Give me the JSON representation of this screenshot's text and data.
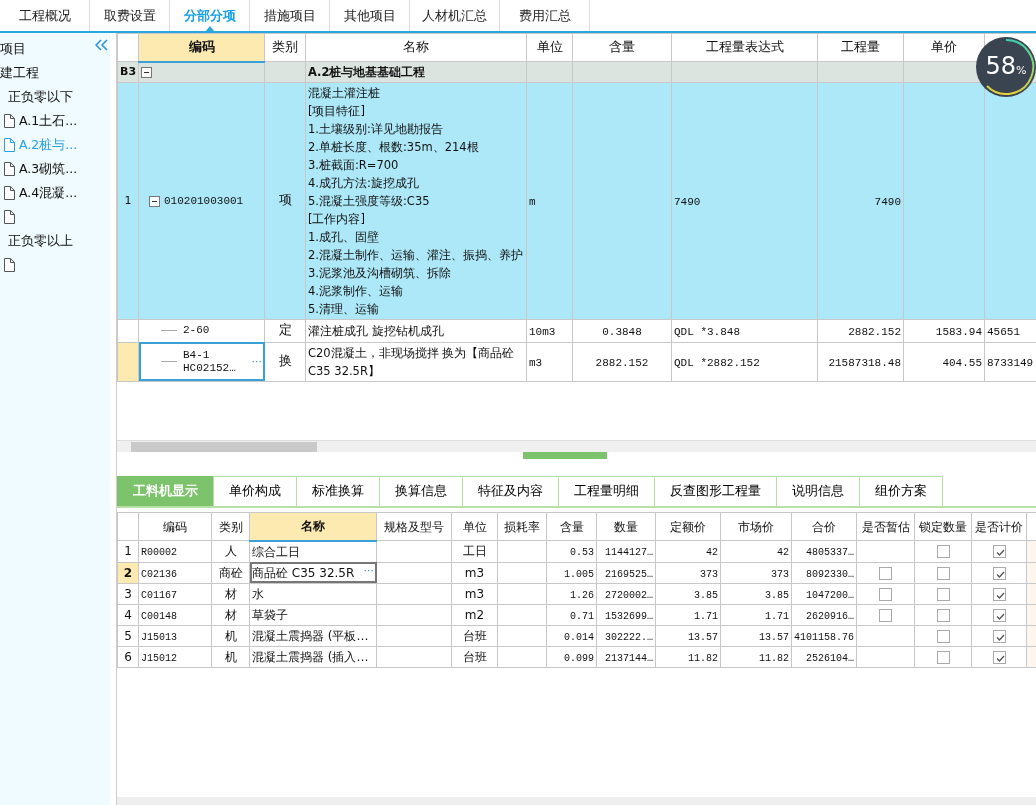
{
  "main_tabs": [
    {
      "label": "工程概况",
      "selected": false
    },
    {
      "label": "取费设置",
      "selected": false
    },
    {
      "label": "分部分项",
      "selected": true
    },
    {
      "label": "措施项目",
      "selected": false
    },
    {
      "label": "其他项目",
      "selected": false
    },
    {
      "label": "人材机汇总",
      "selected": false
    },
    {
      "label": "费用汇总",
      "selected": false
    }
  ],
  "sidebar": {
    "items": [
      {
        "label": "项目",
        "children": [
          {
            "label": "建工程",
            "children": [
              {
                "label": "正负零以下",
                "children": [
                  {
                    "label": "A.1土石...",
                    "selected": false
                  },
                  {
                    "label": "A.2桩与...",
                    "selected": true
                  },
                  {
                    "label": "A.3砌筑...",
                    "selected": false
                  },
                  {
                    "label": "A.4混凝...",
                    "selected": false
                  },
                  {
                    "selected": false
                  }
                ]
              },
              {
                "label": "正负零以上",
                "children": [
                  {
                    "selected": false
                  }
                ]
              }
            ]
          }
        ]
      }
    ]
  },
  "upper_grid": {
    "columns": [
      {
        "label": "编码",
        "selected": true
      },
      {
        "label": "类别",
        "selected": false
      },
      {
        "label": "名称",
        "selected": false
      },
      {
        "label": "单位",
        "selected": false
      },
      {
        "label": "含量",
        "selected": false
      },
      {
        "label": "工程量表达式",
        "selected": false
      },
      {
        "label": "工程量",
        "selected": false
      },
      {
        "label": "单价",
        "selected": false
      },
      {
        "selected": false
      }
    ],
    "rows": [
      {
        "kind": "section",
        "row_label": "B3",
        "expanded": true,
        "selected": false,
        "name": "A.2桩与地基基础工程"
      },
      {
        "kind": "item",
        "row_label": "1",
        "expanded": true,
        "selected": false,
        "code": "010201003001",
        "type": "项",
        "name": "混凝土灌注桩\n[项目特征]\n1.土壤级别:详见地勘报告\n2.单桩长度、根数:35m、214根\n3.桩截面:R=700\n4.成孔方法:旋挖成孔\n5.混凝土强度等级:C35\n[工作内容]\n1.成孔、固壁\n2.混凝土制作、运输、灌注、振捣、养护\n3.泥浆池及沟槽砌筑、拆除\n4.泥浆制作、运输\n5.清理、运输",
        "unit": "m",
        "expr": "7490",
        "qty": "7490"
      },
      {
        "kind": "sub",
        "selected": false,
        "code": "2-60",
        "type": "定",
        "name": "灌注桩成孔 旋挖钻机成孔",
        "unit": "10m3",
        "content": "0.3848",
        "expr": "QDL *3.848",
        "qty": "2882.152",
        "price": "1583.94",
        "total": "45651"
      },
      {
        "kind": "sub",
        "selected": true,
        "code": "B4-1\nHC02152…",
        "more_button": "···",
        "type": "换",
        "name": "C20混凝土，非现场搅拌  换为【商品砼C35 32.5R】",
        "unit": "m3",
        "content": "2882.152",
        "expr": "QDL *2882.152",
        "qty": "21587318.48",
        "price": "404.55",
        "total": "8733149"
      }
    ]
  },
  "progress_badge": {
    "value": "58",
    "unit": "%"
  },
  "lower_tabs": [
    {
      "label": "工料机显示",
      "selected": true
    },
    {
      "label": "单价构成",
      "selected": false
    },
    {
      "label": "标准换算",
      "selected": false
    },
    {
      "label": "换算信息",
      "selected": false
    },
    {
      "label": "特征及内容",
      "selected": false
    },
    {
      "label": "工程量明细",
      "selected": false
    },
    {
      "label": "反查图形工程量",
      "selected": false
    },
    {
      "label": "说明信息",
      "selected": false
    },
    {
      "label": "组价方案",
      "selected": false
    }
  ],
  "lower_grid": {
    "columns": [
      {
        "label": "编码",
        "selected": false
      },
      {
        "label": "类别",
        "selected": false
      },
      {
        "label": "名称",
        "selected": true
      },
      {
        "label": "规格及型号",
        "selected": false
      },
      {
        "label": "单位",
        "selected": false
      },
      {
        "label": "损耗率",
        "selected": false
      },
      {
        "label": "含量",
        "selected": false
      },
      {
        "label": "数量",
        "selected": false
      },
      {
        "label": "定额价",
        "selected": false
      },
      {
        "label": "市场价",
        "selected": false
      },
      {
        "label": "合价",
        "selected": false
      },
      {
        "label": "是否暂估",
        "selected": false
      },
      {
        "label": "锁定数量",
        "selected": false
      },
      {
        "label": "是否计价",
        "selected": false
      }
    ],
    "rows": [
      {
        "num": "1",
        "selected": false,
        "code": "R00002",
        "type": "人",
        "name": "综合工日",
        "unit": "工日",
        "content": "0.53",
        "quantity": "1144127…",
        "quota_price": "42",
        "market_price": "42",
        "total": "4805337…",
        "locked": false,
        "priced": true
      },
      {
        "num": "2",
        "selected": true,
        "code": "C02136",
        "type": "商砼",
        "name": "商品砼 C35 32.5R",
        "more_button": "···",
        "unit": "m3",
        "content": "1.005",
        "quantity": "2169525…",
        "quota_price": "373",
        "market_price": "373",
        "total": "8092330…",
        "provisional": false,
        "locked": false,
        "priced": true
      },
      {
        "num": "3",
        "selected": false,
        "code": "C01167",
        "type": "材",
        "name": "水",
        "unit": "m3",
        "content": "1.26",
        "quantity": "2720002…",
        "quota_price": "3.85",
        "market_price": "3.85",
        "total": "1047200…",
        "provisional": false,
        "locked": false,
        "priced": true
      },
      {
        "num": "4",
        "selected": false,
        "code": "C00148",
        "type": "材",
        "name": "草袋子",
        "unit": "m2",
        "content": "0.71",
        "quantity": "1532699…",
        "quota_price": "1.71",
        "market_price": "1.71",
        "total": "2620916…",
        "provisional": false,
        "locked": false,
        "priced": true
      },
      {
        "num": "5",
        "selected": false,
        "code": "J15013",
        "type": "机",
        "name": "混凝土震捣器 (平板…",
        "unit": "台班",
        "content": "0.014",
        "quantity": "302222.…",
        "quota_price": "13.57",
        "market_price": "13.57",
        "total": "4101158.76",
        "locked": false,
        "priced": true
      },
      {
        "num": "6",
        "selected": false,
        "code": "J15012",
        "type": "机",
        "name": "混凝土震捣器 (插入…",
        "unit": "台班",
        "content": "0.099",
        "quantity": "2137144…",
        "quota_price": "11.82",
        "market_price": "11.82",
        "total": "2526104…",
        "locked": false,
        "priced": true
      }
    ]
  }
}
